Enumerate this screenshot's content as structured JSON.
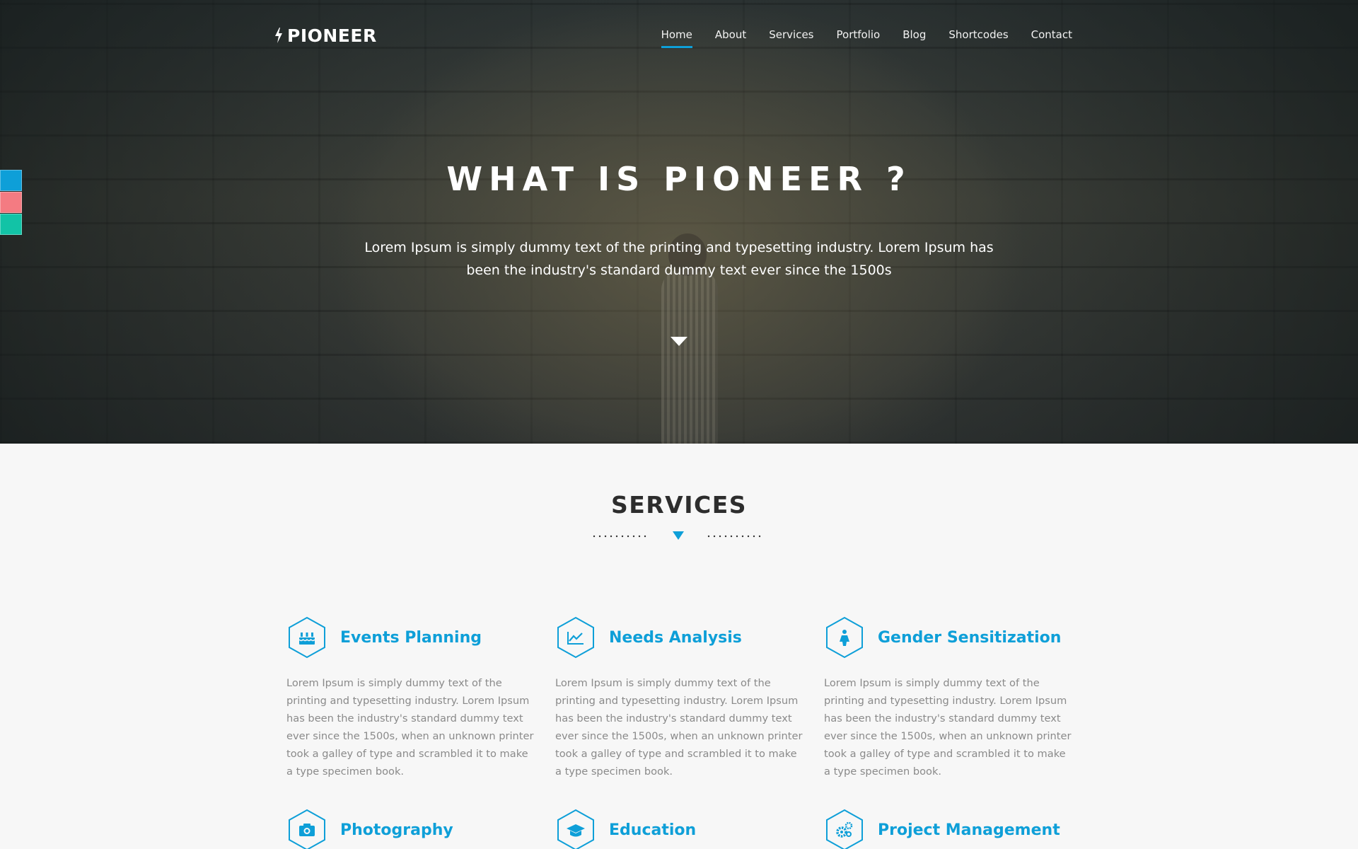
{
  "brand": {
    "name": "PIONEER",
    "icon": "lightning-bolt-icon"
  },
  "nav": {
    "items": [
      {
        "label": "Home",
        "active": true
      },
      {
        "label": "About"
      },
      {
        "label": "Services"
      },
      {
        "label": "Portfolio"
      },
      {
        "label": "Blog"
      },
      {
        "label": "Shortcodes"
      },
      {
        "label": "Contact"
      }
    ]
  },
  "hero": {
    "title": "WHAT IS PIONEER ?",
    "text": "Lorem Ipsum is simply dummy text of the printing and typesetting industry. Lorem Ipsum has been the industry's standard dummy text ever since the 1500s",
    "scroll_icon": "chevron-down-icon"
  },
  "color_switcher": [
    "#0e9fd8",
    "#f47b82",
    "#12c3a6"
  ],
  "services": {
    "title": "SERVICES",
    "items": [
      {
        "title": "Events Planning",
        "icon": "cake-icon",
        "text": "Lorem Ipsum is simply dummy text of the printing and typesetting industry. Lorem Ipsum has been the industry's standard dummy text ever since the 1500s, when an unknown printer took a galley of type and scrambled it to make a type specimen book."
      },
      {
        "title": "Needs Analysis",
        "icon": "chart-line-icon",
        "text": "Lorem Ipsum is simply dummy text of the printing and typesetting industry. Lorem Ipsum has been the industry's standard dummy text ever since the 1500s, when an unknown printer took a galley of type and scrambled it to make a type specimen book."
      },
      {
        "title": "Gender Sensitization",
        "icon": "person-icon",
        "text": "Lorem Ipsum is simply dummy text of the printing and typesetting industry. Lorem Ipsum has been the industry's standard dummy text ever since the 1500s, when an unknown printer took a galley of type and scrambled it to make a type specimen book."
      },
      {
        "title": "Photography",
        "icon": "camera-icon"
      },
      {
        "title": "Education",
        "icon": "graduation-cap-icon"
      },
      {
        "title": "Project Management",
        "icon": "gears-icon"
      }
    ]
  },
  "colors": {
    "accent": "#0e9fd8",
    "heading": "#2d2d2d",
    "body_text": "#8a8a8a",
    "page_bg": "#f7f7f7"
  }
}
